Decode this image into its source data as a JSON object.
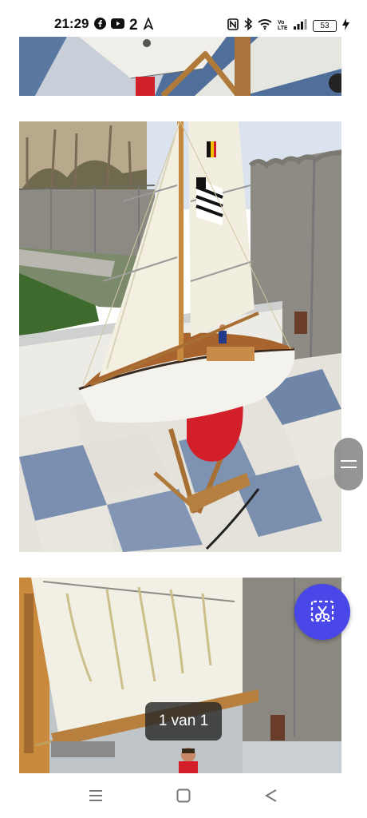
{
  "status_bar": {
    "time": "21:29",
    "notification_count": "2",
    "battery_level": "53",
    "icons": [
      "facebook-icon",
      "youtube-icon",
      "count-badge",
      "location-arrow-icon",
      "nfc-icon",
      "bluetooth-icon",
      "wifi-icon",
      "volte-icon",
      "signal-icon",
      "battery-icon",
      "charging-icon"
    ]
  },
  "viewer": {
    "page_indicator": "1 van 1",
    "photos": [
      "sailboat-photo-top",
      "sailboat-photo-main",
      "sailboat-photo-sail-detail"
    ]
  },
  "fab": {
    "icon": "screenshot-crop-icon",
    "color": "#4a47e8"
  },
  "nav_bar": {
    "icons": [
      "menu-icon",
      "home-icon",
      "back-icon"
    ]
  }
}
